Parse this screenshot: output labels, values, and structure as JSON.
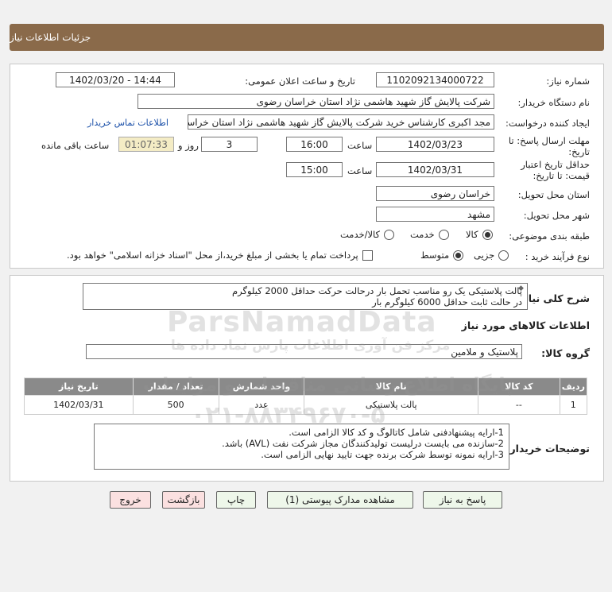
{
  "header": {
    "title": "جزئیات اطلاعات نیاز"
  },
  "form": {
    "need_number_label": "شماره نیاز:",
    "need_number": "1102092134000722",
    "announce_label": "تاریخ و ساعت اعلان عمومی:",
    "announce_value": "1402/03/20 - 14:44",
    "buyer_label": "نام دستگاه خریدار:",
    "buyer_value": "شرکت پالایش گاز شهید هاشمی نژاد   استان خراسان رضوی",
    "creator_label": "ایجاد کننده درخواست:",
    "creator_value": "مجد اکبری کارشناس خرید شرکت پالایش گاز شهید هاشمی نژاد   استان خراسان رضوی",
    "contact_link": "اطلاعات تماس خریدار",
    "deadline_label_1": "مهلت ارسال پاسخ: تا",
    "deadline_label_2": "تاریخ:",
    "deadline_date": "1402/03/23",
    "time_label": "ساعت",
    "deadline_time": "16:00",
    "days_value": "3",
    "days_label": "روز و",
    "remaining_time": "01:07:33",
    "remaining_label": "ساعت باقی مانده",
    "validity_label_1": "حداقل تاریخ اعتبار",
    "validity_label_2": "قیمت: تا تاریخ:",
    "validity_date": "1402/03/31",
    "validity_time_label": "ساعت",
    "validity_time": "15:00",
    "province_label": "استان محل تحویل:",
    "province_value": "خراسان رضوی",
    "city_label": "شهر محل تحویل:",
    "city_value": "مشهد",
    "category_label": "طبقه بندی موضوعی:",
    "category_options": [
      "کالا",
      "خدمت",
      "کالا/خدمت"
    ],
    "process_label": "نوع فرآیند خرید :",
    "process_options": [
      "جزیی",
      "متوسط"
    ],
    "payment_note": "پرداخت تمام یا بخشی از مبلغ خرید،از محل \"اسناد خزانه اسلامی\" خواهد بود."
  },
  "description": {
    "label": "شرح کلی نیاز:",
    "line1": "پالت پلاستیکی یک رو مناسب تحمل بار درحالت حرکت حداقل 2000 کیلوگرم",
    "line2": "در حالت ثابت حداقل 6000 کیلوگرم بار"
  },
  "goods": {
    "section_title": "اطلاعات کالاهای مورد نیاز",
    "group_label": "گروه کالا:",
    "group_value": "پلاستیک و ملامین",
    "columns": [
      "ردیف",
      "کد کالا",
      "نام کالا",
      "واحد شمارش",
      "تعداد / مقدار",
      "تاریخ نیاز"
    ],
    "rows": [
      [
        "1",
        "--",
        "پالت پلاستیکی",
        "عدد",
        "500",
        "1402/03/31"
      ]
    ]
  },
  "buyer_notes": {
    "label": "توضیحات خریدار:",
    "line1": "1-ارایه پیشنهادفنی شامل کاتالوگ و کد کالا  الزامی است.",
    "line2": "2-سازنده می بایست درلیست تولیدکنندگان مجاز شرکت نفت (AVL)  باشد.",
    "line3": "3-ارایه نمونه توسط شرکت برنده جهت تایید نهایی الزامی است."
  },
  "buttons": {
    "reply": "پاسخ به نیاز",
    "view_docs": "مشاهده مدارک پیوستی (1)",
    "print": "چاپ",
    "back": "بازگشت",
    "exit": "خروج"
  },
  "watermark": {
    "brand": "ParsNamadData",
    "line1": "پایگاه اطلاع رسانی مناقصات و مزایدات",
    "line2": "مرکز فن آوری اطلاعات پارس نماد داده ها",
    "phone": "۰۲۱-۸۸۳۴۹۶۷۰-۵"
  }
}
